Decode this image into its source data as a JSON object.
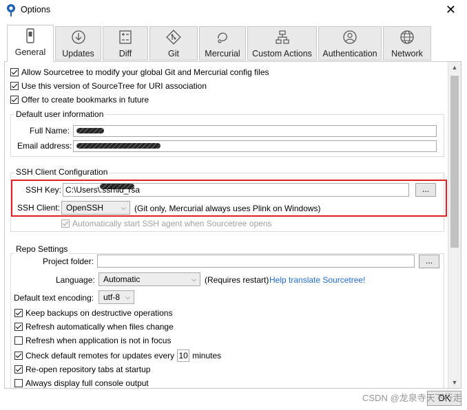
{
  "window": {
    "title": "Options",
    "close_glyph": "✕"
  },
  "tabs": [
    {
      "label": "General",
      "icon": "phone-settings-icon",
      "active": true
    },
    {
      "label": "Updates",
      "icon": "download-icon",
      "active": false
    },
    {
      "label": "Diff",
      "icon": "diff-icon",
      "active": false
    },
    {
      "label": "Git",
      "icon": "git-icon",
      "active": false
    },
    {
      "label": "Mercurial",
      "icon": "mercurial-icon",
      "active": false
    },
    {
      "label": "Custom Actions",
      "icon": "custom-actions-icon",
      "active": false
    },
    {
      "label": "Authentication",
      "icon": "user-icon",
      "active": false
    },
    {
      "label": "Network",
      "icon": "globe-icon",
      "active": false
    }
  ],
  "general": {
    "allow_global_config": {
      "label": "Allow Sourcetree to modify your global Git and Mercurial config files",
      "checked": true
    },
    "uri_association": {
      "label": "Use this version of SourceTree for URI association",
      "checked": true
    },
    "create_bookmarks": {
      "label": "Offer to create bookmarks in future",
      "checked": true
    }
  },
  "user_info": {
    "title": "Default user information",
    "full_name_label": "Full Name:",
    "email_label": "Email address:"
  },
  "ssh": {
    "title": "SSH Client Configuration",
    "key_label": "SSH Key:",
    "key_prefix": "C:\\Users\\",
    "key_suffix": ".ssh\\id_rsa",
    "browse": "...",
    "client_label": "SSH Client:",
    "client_value": "OpenSSH",
    "client_note": "(Git only, Mercurial always uses Plink on Windows)",
    "auto_agent": {
      "label": "Automatically start SSH agent when Sourcetree opens",
      "checked": true
    }
  },
  "repo": {
    "title": "Repo Settings",
    "project_folder_label": "Project folder:",
    "browse": "...",
    "language_label": "Language:",
    "language_value": "Automatic",
    "language_note": "(Requires restart)",
    "translate_link": "Help translate Sourcetree!",
    "encoding_label": "Default text encoding:",
    "encoding_value": "utf-8",
    "keep_backups": {
      "label": "Keep backups on destructive operations",
      "checked": true
    },
    "refresh_auto": {
      "label": "Refresh automatically when files change",
      "checked": true
    },
    "refresh_focus": {
      "label": "Refresh when application is not in focus",
      "checked": false
    },
    "check_remotes": {
      "label_before": "Check default remotes for updates every",
      "minutes_value": "10",
      "label_after": "minutes",
      "checked": true
    },
    "reopen_tabs": {
      "label": "Re-open repository tabs at startup",
      "checked": true
    },
    "console_output": {
      "label": "Always display full console output",
      "checked": false
    }
  },
  "buttons": {
    "ok": "OK"
  },
  "watermark": "CSDN @龙泉寺天下行走"
}
